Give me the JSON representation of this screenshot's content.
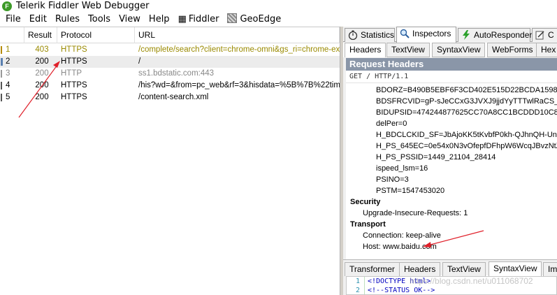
{
  "window": {
    "title": "Telerik Fiddler Web Debugger",
    "logo_letter": "F"
  },
  "menu": {
    "items": [
      "File",
      "Edit",
      "Rules",
      "Tools",
      "View",
      "Help"
    ],
    "fiddler_label": "Fiddler",
    "geoedge_label": "GeoEdge"
  },
  "sessions": {
    "columns": {
      "result": "Result",
      "protocol": "Protocol",
      "url": "URL"
    },
    "rows": [
      {
        "num": "1",
        "result": "403",
        "protocol": "HTTPS",
        "url": "/complete/search?client=chrome-omni&gs_ri=chrome-ext-ar"
      },
      {
        "num": "2",
        "result": "200",
        "protocol": "HTTPS",
        "url": "/"
      },
      {
        "num": "3",
        "result": "200",
        "protocol": "HTTP",
        "url": "ss1.bdstatic.com:443"
      },
      {
        "num": "4",
        "result": "200",
        "protocol": "HTTPS",
        "url": "/his?wd=&from=pc_web&rf=3&hisdata=%5B%7B%22time"
      },
      {
        "num": "5",
        "result": "200",
        "protocol": "HTTPS",
        "url": "/content-search.xml"
      }
    ]
  },
  "tool_tabs": {
    "statistics": "Statistics",
    "inspectors": "Inspectors",
    "autoresponder": "AutoResponder",
    "composer_partial": "C"
  },
  "inspector_tabs": [
    "Headers",
    "TextView",
    "SyntaxView",
    "WebForms",
    "Hex"
  ],
  "request": {
    "title": "Request Headers",
    "request_line": "GET / HTTP/1.1",
    "cookies": [
      "BDORZ=B490B5EBF6F3CD402E515D22BCDA1598",
      "BDSFRCVID=gP-sJeCCxG3JVXJ9jjdYyTTTwlRaCS_xAs",
      "BIDUPSID=474244877625CC70A8CC1BCDDD10C8AC",
      "delPer=0",
      "H_BDCLCKID_SF=JbAjoKK5tKvbfP0kh-QJhnQH-UnLq-",
      "H_PS_645EC=0e54x0N3vOfepfDFhpW6WcqJBvzNtZc",
      "H_PS_PSSID=1449_21104_28414",
      "ispeed_lsm=16",
      "PSINO=3",
      "PSTM=1547453020"
    ],
    "security_group": "Security",
    "security_items": [
      "Upgrade-Insecure-Requests: 1"
    ],
    "transport_group": "Transport",
    "transport_items": [
      "Connection: keep-alive",
      "Host: www.baidu.com"
    ]
  },
  "lower_tabs": [
    "Transformer",
    "Headers",
    "TextView",
    "SyntaxView",
    "Im"
  ],
  "code": {
    "lines": [
      {
        "num": "1",
        "text": "<!DOCTYPE html>"
      },
      {
        "num": "2",
        "text": "<!--STATUS OK-->"
      }
    ],
    "watermark": "https://blog.csdn.net/u011068702"
  },
  "colors": {
    "annotation_arrow": "#e0202a",
    "header_bar": "#8a96a8",
    "orange_row_text": "#9a8a00"
  }
}
